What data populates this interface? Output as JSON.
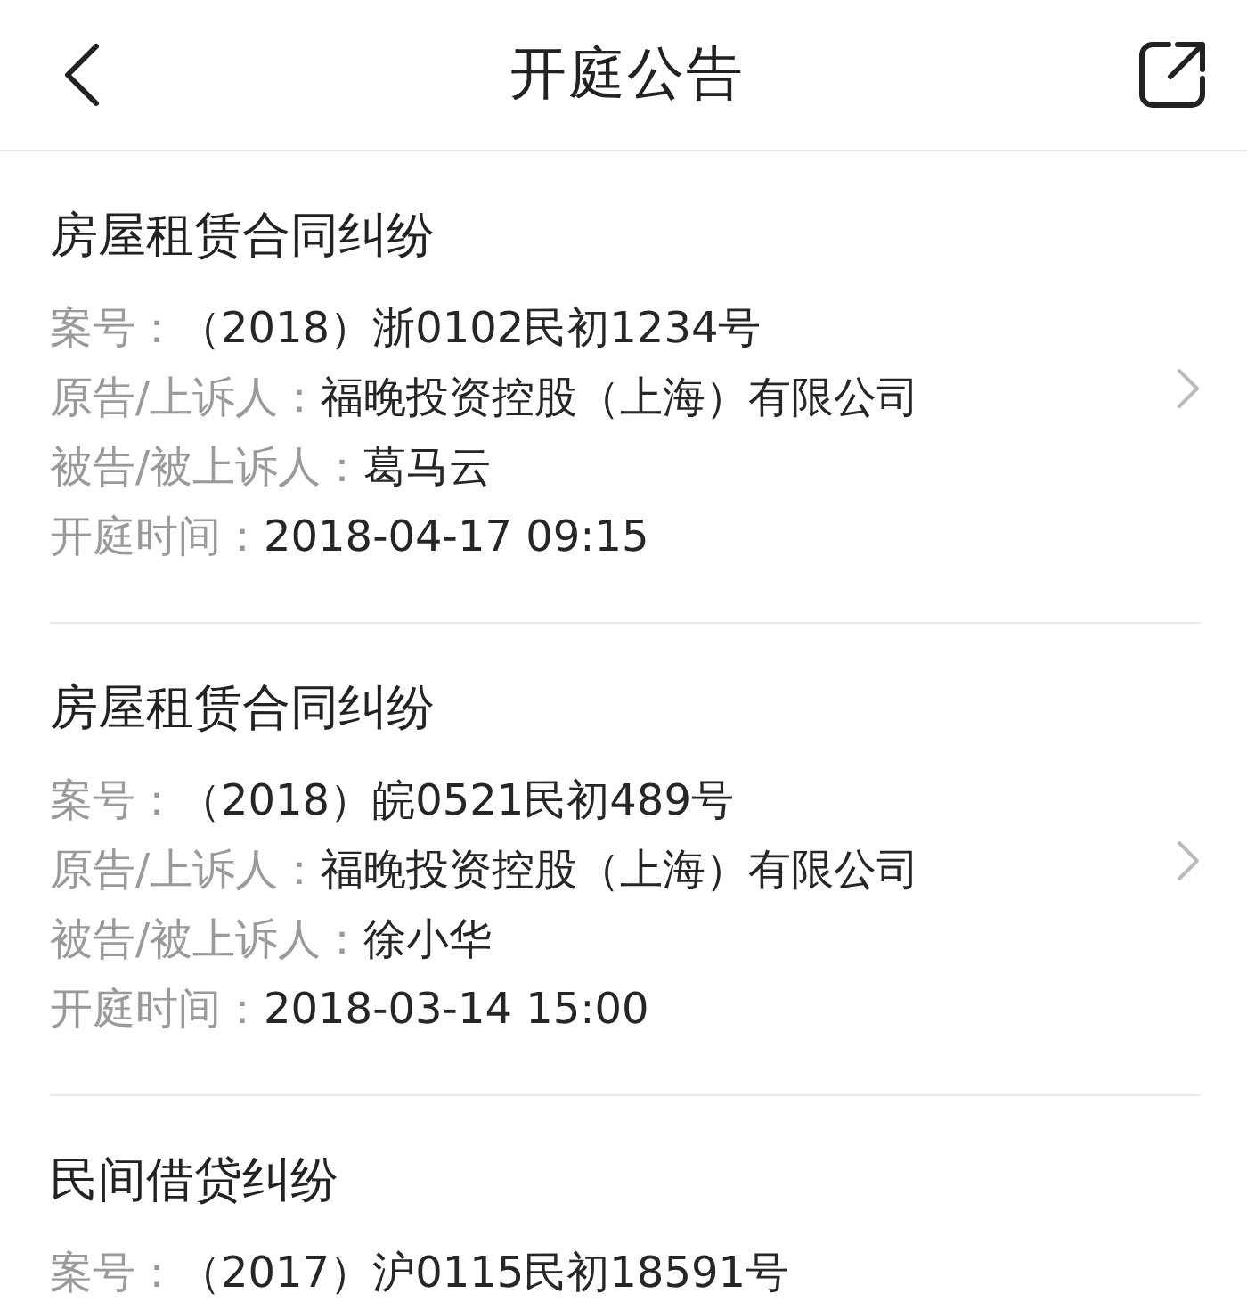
{
  "header": {
    "title": "开庭公告"
  },
  "cases": [
    {
      "title": "房屋租赁合同纠纷",
      "arrow": true,
      "fields": [
        {
          "label": "案号：",
          "value": "（2018）浙0102民初1234号"
        },
        {
          "label": "原告/上诉人：",
          "value": "福晚投资控股（上海）有限公司"
        },
        {
          "label": "被告/被上诉人：",
          "value": "葛马云"
        },
        {
          "label": "开庭时间：",
          "value": "2018-04-17 09:15"
        }
      ]
    },
    {
      "title": "房屋租赁合同纠纷",
      "arrow": true,
      "fields": [
        {
          "label": "案号：",
          "value": "（2018）皖0521民初489号"
        },
        {
          "label": "原告/上诉人：",
          "value": "福晚投资控股（上海）有限公司"
        },
        {
          "label": "被告/被上诉人：",
          "value": "徐小华"
        },
        {
          "label": "开庭时间：",
          "value": "2018-03-14 15:00"
        }
      ]
    },
    {
      "title": "民间借贷纠纷",
      "arrow": false,
      "fields": [
        {
          "label": "案号：",
          "value": "（2017）沪0115民初18591号"
        }
      ]
    }
  ]
}
